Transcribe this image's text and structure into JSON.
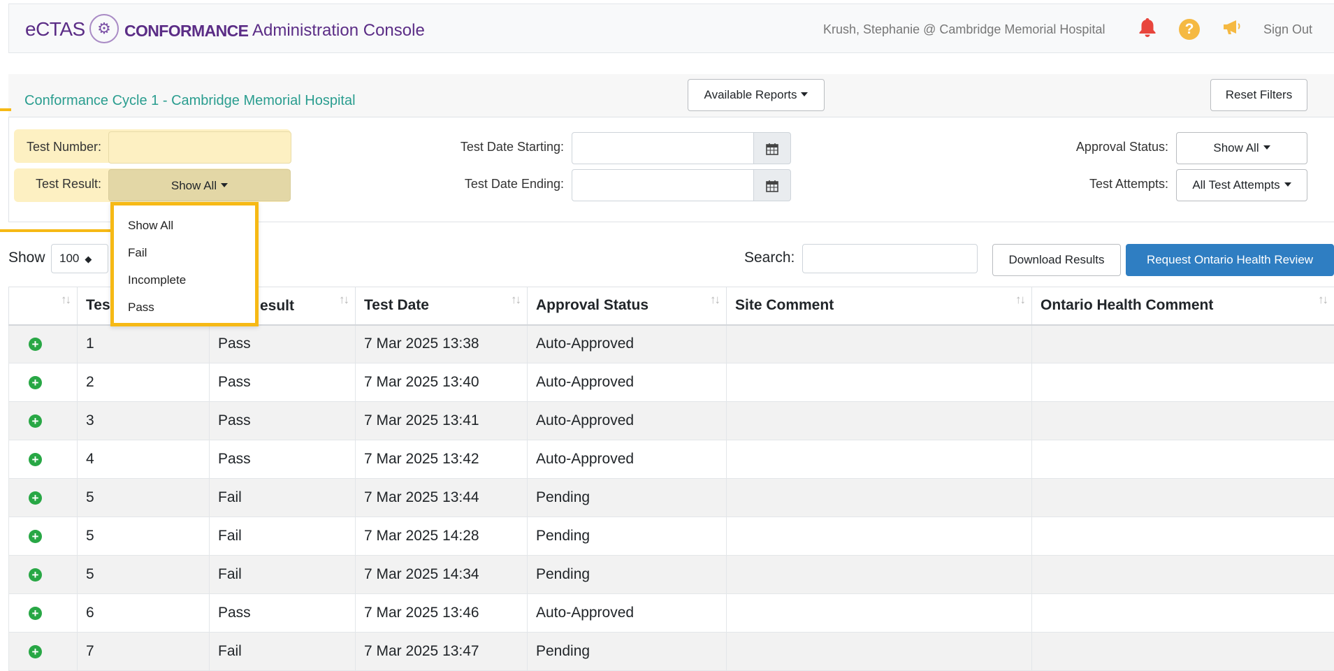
{
  "header": {
    "brand_ectas": "eCTAS",
    "brand_conformance": "CONFORMANCE",
    "brand_admin": "Administration Console",
    "user": "Krush, Stephanie @ Cambridge Memorial Hospital",
    "help_symbol": "?",
    "sign_out": "Sign Out",
    "colors": {
      "brand": "#5b2d86",
      "bell": "#e8453c",
      "help": "#f5b942"
    }
  },
  "filters": {
    "title": "Conformance Cycle 1 - Cambridge Memorial Hospital",
    "available_reports": "Available Reports",
    "reset_filters": "Reset Filters",
    "test_number_label": "Test Number:",
    "test_number_value": "",
    "test_result_label": "Test Result:",
    "test_result_value": "Show All",
    "test_date_starting_label": "Test Date Starting:",
    "test_date_ending_label": "Test Date Ending:",
    "approval_status_label": "Approval Status:",
    "approval_status_value": "Show All",
    "test_attempts_label": "Test Attempts:",
    "test_attempts_value": "All Test Attempts"
  },
  "dropdown": {
    "options": [
      "Show All",
      "Fail",
      "Incomplete",
      "Pass"
    ],
    "highlight_color": "#f6b915"
  },
  "toolbar": {
    "show_label": "Show",
    "page_size": "100",
    "search_label": "Search:",
    "download_results": "Download Results",
    "request_review": "Request Ontario Health Review",
    "primary_color": "#2f7ec2"
  },
  "table": {
    "columns": [
      "",
      "Test Number",
      "Test Result",
      "Test Date",
      "Approval Status",
      "Site Comment",
      "Ontario Health Comment"
    ],
    "visible_headers": {
      "test_number": "Tes",
      "test_result": "esult"
    },
    "rows": [
      {
        "num": "1",
        "result": "Pass",
        "date": "7 Mar 2025 13:38",
        "status": "Auto-Approved"
      },
      {
        "num": "2",
        "result": "Pass",
        "date": "7 Mar 2025 13:40",
        "status": "Auto-Approved"
      },
      {
        "num": "3",
        "result": "Pass",
        "date": "7 Mar 2025 13:41",
        "status": "Auto-Approved"
      },
      {
        "num": "4",
        "result": "Pass",
        "date": "7 Mar 2025 13:42",
        "status": "Auto-Approved"
      },
      {
        "num": "5",
        "result": "Fail",
        "date": "7 Mar 2025 13:44",
        "status": "Pending"
      },
      {
        "num": "5",
        "result": "Fail",
        "date": "7 Mar 2025 14:28",
        "status": "Pending"
      },
      {
        "num": "5",
        "result": "Fail",
        "date": "7 Mar 2025 14:34",
        "status": "Pending"
      },
      {
        "num": "6",
        "result": "Pass",
        "date": "7 Mar 2025 13:46",
        "status": "Auto-Approved"
      },
      {
        "num": "7",
        "result": "Fail",
        "date": "7 Mar 2025 13:47",
        "status": "Pending"
      }
    ]
  }
}
